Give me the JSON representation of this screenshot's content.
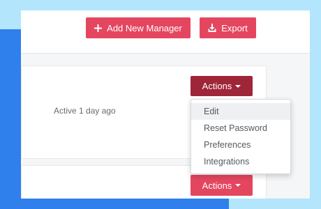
{
  "colors": {
    "primary_red": "#e44660",
    "active_red": "#9f2538",
    "backdrop_light_blue": "#b3e5fc",
    "backdrop_blue": "#2f80ed"
  },
  "toolbar": {
    "add_manager": {
      "label": "Add New Manager",
      "icon": "plus-icon"
    },
    "export": {
      "label": "Export",
      "icon": "download-icon"
    }
  },
  "manager_row": {
    "status": "Active 1 day ago",
    "actions_label": "Actions"
  },
  "actions_menu": {
    "items": [
      {
        "label": "Edit",
        "highlighted": true
      },
      {
        "label": "Reset Password",
        "highlighted": false
      },
      {
        "label": "Preferences",
        "highlighted": false
      },
      {
        "label": "Integrations",
        "highlighted": false
      }
    ]
  },
  "second_row": {
    "actions_label": "Actions"
  }
}
